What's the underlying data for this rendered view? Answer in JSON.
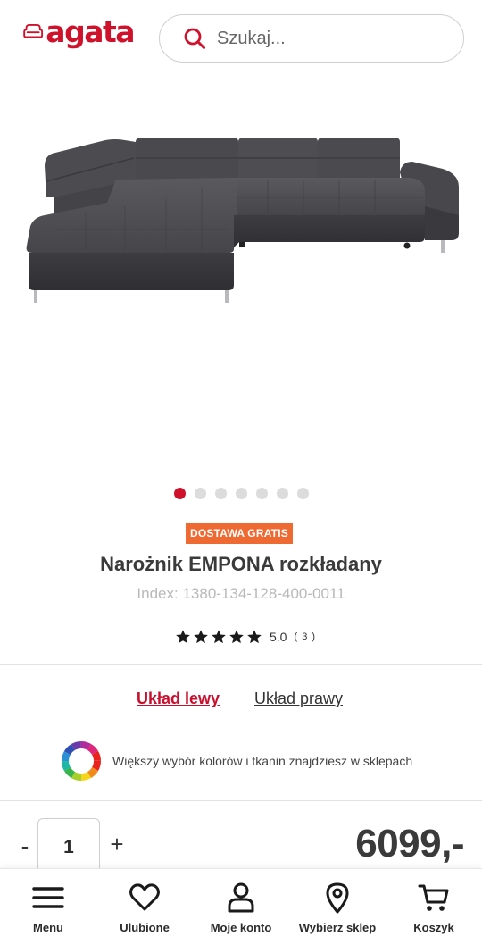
{
  "header": {
    "logo_text": "agata",
    "search_placeholder": "Szukaj..."
  },
  "gallery": {
    "total_images": 7,
    "active_index": 0
  },
  "product": {
    "badge": "DOSTAWA GRATIS",
    "title": "Narożnik EMPONA rozkładany",
    "index": "Index: 1380-134-128-400-0011",
    "rating": 5,
    "rating_value": "5.0",
    "rating_count": "( 3 )"
  },
  "layout_options": {
    "left": "Układ lewy",
    "right": "Układ prawy"
  },
  "color_info": "Większy wybór kolorów i tkanin znajdziesz w sklepach",
  "purchase": {
    "minus": "-",
    "quantity": "1",
    "plus": "+",
    "price": "6099,-"
  },
  "bottom_nav": {
    "menu": "Menu",
    "favorites": "Ulubione",
    "account": "Moje konto",
    "store": "Wybierz sklep",
    "cart": "Koszyk"
  },
  "colors": {
    "brand_red": "#d0112b",
    "badge_orange": "#ef6a32",
    "sofa_gray": "#4a4a4e"
  }
}
